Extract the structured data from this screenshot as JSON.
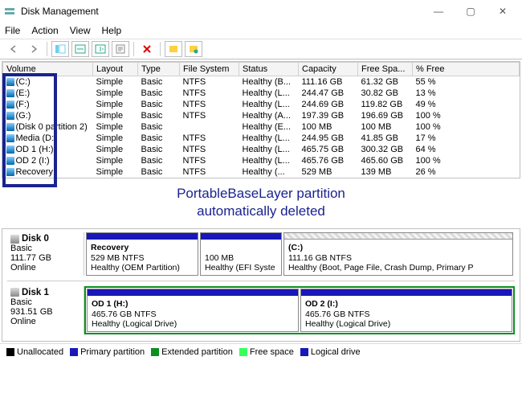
{
  "window": {
    "title": "Disk Management"
  },
  "menu": {
    "file": "File",
    "action": "Action",
    "view": "View",
    "help": "Help"
  },
  "columns": {
    "volume": "Volume",
    "layout": "Layout",
    "type": "Type",
    "fs": "File System",
    "status": "Status",
    "capacity": "Capacity",
    "free": "Free Spa...",
    "pct": "% Free"
  },
  "vol": [
    {
      "v": "(C:)",
      "l": "Simple",
      "t": "Basic",
      "f": "NTFS",
      "s": "Healthy (B...",
      "c": "111.16 GB",
      "fr": "61.32 GB",
      "p": "55 %"
    },
    {
      "v": "(E:)",
      "l": "Simple",
      "t": "Basic",
      "f": "NTFS",
      "s": "Healthy (L...",
      "c": "244.47 GB",
      "fr": "30.82 GB",
      "p": "13 %"
    },
    {
      "v": "(F:)",
      "l": "Simple",
      "t": "Basic",
      "f": "NTFS",
      "s": "Healthy (L...",
      "c": "244.69 GB",
      "fr": "119.82 GB",
      "p": "49 %"
    },
    {
      "v": "(G:)",
      "l": "Simple",
      "t": "Basic",
      "f": "NTFS",
      "s": "Healthy (A...",
      "c": "197.39 GB",
      "fr": "196.69 GB",
      "p": "100 %"
    },
    {
      "v": "(Disk 0 partition 2)",
      "l": "Simple",
      "t": "Basic",
      "f": "",
      "s": "Healthy (E...",
      "c": "100 MB",
      "fr": "100 MB",
      "p": "100 %"
    },
    {
      "v": "Media (D:)",
      "l": "Simple",
      "t": "Basic",
      "f": "NTFS",
      "s": "Healthy (L...",
      "c": "244.95 GB",
      "fr": "41.85 GB",
      "p": "17 %"
    },
    {
      "v": "OD 1 (H:)",
      "l": "Simple",
      "t": "Basic",
      "f": "NTFS",
      "s": "Healthy (L...",
      "c": "465.75 GB",
      "fr": "300.32 GB",
      "p": "64 %"
    },
    {
      "v": "OD 2 (I:)",
      "l": "Simple",
      "t": "Basic",
      "f": "NTFS",
      "s": "Healthy (L...",
      "c": "465.76 GB",
      "fr": "465.60 GB",
      "p": "100 %"
    },
    {
      "v": "Recovery",
      "l": "Simple",
      "t": "Basic",
      "f": "NTFS",
      "s": "Healthy (...",
      "c": "529 MB",
      "fr": "139 MB",
      "p": "26 %"
    }
  ],
  "annotation": {
    "line1": "PortableBaseLayer partition",
    "line2": "automatically deleted"
  },
  "disk0": {
    "name": "Disk 0",
    "type": "Basic",
    "cap": "111.77 GB",
    "status": "Online",
    "p0": {
      "name": "Recovery",
      "sz": "529 MB NTFS",
      "st": "Healthy (OEM Partition)"
    },
    "p1": {
      "name": "",
      "sz": "100 MB",
      "st": "Healthy (EFI Syste"
    },
    "p2": {
      "name": "(C:)",
      "sz": "111.16 GB NTFS",
      "st": "Healthy (Boot, Page File, Crash Dump, Primary P"
    }
  },
  "disk1": {
    "name": "Disk 1",
    "type": "Basic",
    "cap": "931.51 GB",
    "status": "Online",
    "p0": {
      "name": "OD 1  (H:)",
      "sz": "465.76 GB NTFS",
      "st": "Healthy (Logical Drive)"
    },
    "p1": {
      "name": "OD 2  (I:)",
      "sz": "465.76 GB NTFS",
      "st": "Healthy (Logical Drive)"
    }
  },
  "legend": {
    "unalloc": "Unallocated",
    "primary": "Primary partition",
    "extended": "Extended partition",
    "free": "Free space",
    "logical": "Logical drive"
  },
  "colors": {
    "unalloc": "#000000",
    "primary": "#1818b8",
    "extended": "#0a9020",
    "free": "#39ff5a",
    "logical": "#1818b8"
  }
}
